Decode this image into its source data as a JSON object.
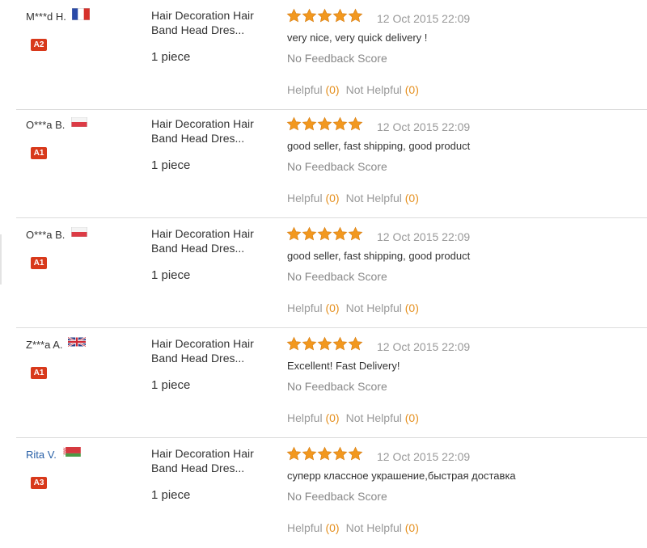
{
  "reviews": [
    {
      "user": "M***d H.",
      "user_is_link": false,
      "flag": "france",
      "badge": "A2",
      "product": "Hair Decoration Hair Band Head Dres...",
      "quantity": "1 piece",
      "rating": 5,
      "date": "12 Oct 2015 22:09",
      "comment": "very nice, very quick delivery !",
      "feedback": "No Feedback Score",
      "helpful_label": "Helpful",
      "helpful_count": "(0)",
      "not_helpful_label": "Not Helpful",
      "not_helpful_count": "(0)"
    },
    {
      "user": "O***a B.",
      "user_is_link": false,
      "flag": "poland",
      "badge": "A1",
      "product": "Hair Decoration Hair Band Head Dres...",
      "quantity": "1 piece",
      "rating": 5,
      "date": "12 Oct 2015 22:09",
      "comment": "good seller, fast shipping, good product",
      "feedback": "No Feedback Score",
      "helpful_label": "Helpful",
      "helpful_count": "(0)",
      "not_helpful_label": "Not Helpful",
      "not_helpful_count": "(0)"
    },
    {
      "user": "O***a B.",
      "user_is_link": false,
      "flag": "poland",
      "badge": "A1",
      "product": "Hair Decoration Hair Band Head Dres...",
      "quantity": "1 piece",
      "rating": 5,
      "date": "12 Oct 2015 22:09",
      "comment": "good seller, fast shipping, good product",
      "feedback": "No Feedback Score",
      "helpful_label": "Helpful",
      "helpful_count": "(0)",
      "not_helpful_label": "Not Helpful",
      "not_helpful_count": "(0)"
    },
    {
      "user": "Z***a A.",
      "user_is_link": false,
      "flag": "uk",
      "badge": "A1",
      "product": "Hair Decoration Hair Band Head Dres...",
      "quantity": "1 piece",
      "rating": 5,
      "date": "12 Oct 2015 22:09",
      "comment": "Excellent! Fast Delivery!",
      "feedback": "No Feedback Score",
      "helpful_label": "Helpful",
      "helpful_count": "(0)",
      "not_helpful_label": "Not Helpful",
      "not_helpful_count": "(0)"
    },
    {
      "user": "Rita V.",
      "user_is_link": true,
      "flag": "belarus",
      "badge": "A3",
      "product": "Hair Decoration Hair Band Head Dres...",
      "quantity": "1 piece",
      "rating": 5,
      "date": "12 Oct 2015 22:09",
      "comment": "суперр классное украшение,быстрая доставка",
      "feedback": "No Feedback Score",
      "helpful_label": "Helpful",
      "helpful_count": "(0)",
      "not_helpful_label": "Not Helpful",
      "not_helpful_count": "(0)"
    }
  ],
  "colors": {
    "star": "#f2981f",
    "badge": "#d8391b",
    "link": "#2b62a8",
    "count": "#e5901f"
  }
}
